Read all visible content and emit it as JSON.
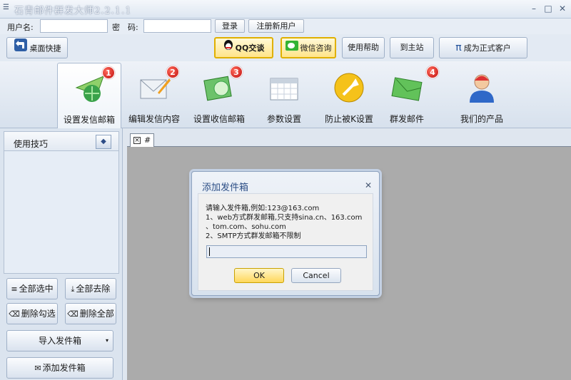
{
  "window": {
    "title": "石青邮件群发大师2.2.1.1",
    "minimize": "–",
    "maximize": "□",
    "close": "✕"
  },
  "login": {
    "username_label": "用户名:",
    "username_value": "",
    "password_label": "密　码:",
    "password_value": "",
    "login_button": "登录",
    "register_button": "注册新用户"
  },
  "toolbar": {
    "desktop_shortcut": "桌面快捷",
    "qq_chat": "QQ交谈",
    "wechat_consult": "微信咨询",
    "help": "使用帮助",
    "home": "到主站",
    "become_customer": "成为正式客户",
    "pi_symbol": "π"
  },
  "tabs": [
    {
      "label": "设置发信邮箱",
      "badge": "1",
      "icon": "mail-send-icon"
    },
    {
      "label": "编辑发信内容",
      "badge": "2",
      "icon": "envelope-edit-icon"
    },
    {
      "label": "设置收信邮箱",
      "badge": "3",
      "icon": "receive-mail-icon"
    },
    {
      "label": "参数设置",
      "badge": "",
      "icon": "calendar-icon"
    },
    {
      "label": "防止被K设置",
      "badge": "",
      "icon": "wrench-icon"
    },
    {
      "label": "群发邮件",
      "badge": "4",
      "icon": "green-envelope-icon"
    },
    {
      "label": "我们的产品",
      "badge": "",
      "icon": "user-icon"
    }
  ],
  "left": {
    "tips_title": "使用技巧",
    "select_all": "全部选中",
    "remove_all": "全部去除",
    "delete_checked": "删除勾选",
    "delete_all": "删除全部",
    "import_boxes": "导入发件箱",
    "add_box": "添加发件箱"
  },
  "doc": {
    "tab_label": "#"
  },
  "dialog": {
    "title": "添加发件箱",
    "line1": "请输入发件箱,例如:123@163.com",
    "line2": "1、web方式群发邮箱,只支持sina.cn、163.com",
    "line3": "、tom.com、sohu.com",
    "line4": "2、SMTP方式群发邮箱不限制",
    "input_value": "",
    "ok": "OK",
    "cancel": "Cancel"
  }
}
